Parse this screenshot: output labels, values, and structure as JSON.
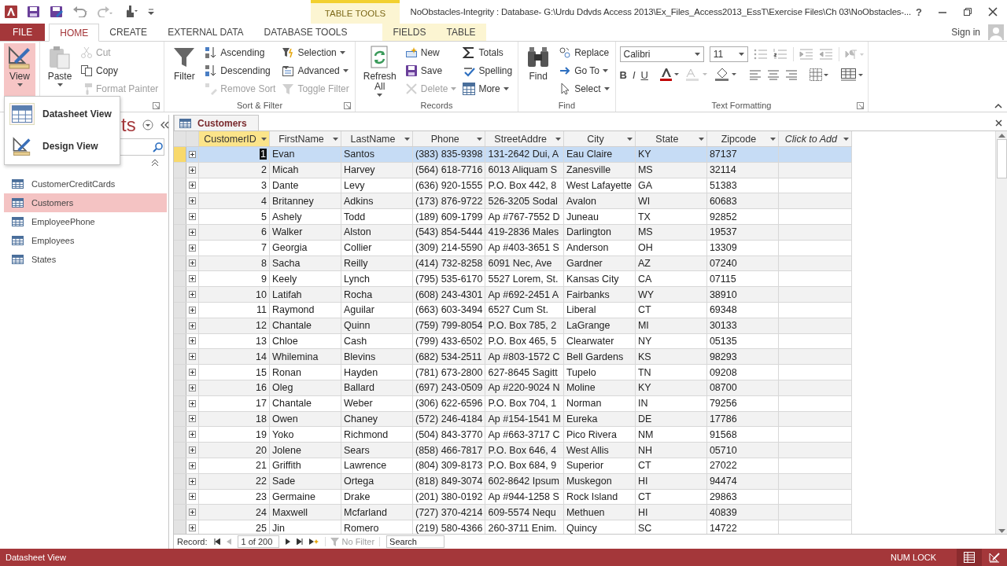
{
  "window": {
    "contextual_header": "TABLE TOOLS",
    "title": "NoObstacles-Integrity : Database- G:\\Urdu Ddvds Access 2013\\Ex_Files_Access2013_EssT\\Exercise Files\\Ch 03\\NoObstacles-...",
    "help": "?"
  },
  "tabs": [
    {
      "label": "FILE",
      "kind": "file",
      "selected": false
    },
    {
      "label": "HOME",
      "kind": "tab",
      "selected": true
    },
    {
      "label": "CREATE",
      "kind": "tab",
      "selected": false
    },
    {
      "label": "EXTERNAL DATA",
      "kind": "tab",
      "selected": false
    },
    {
      "label": "DATABASE TOOLS",
      "kind": "tab",
      "selected": false
    },
    {
      "label": "FIELDS",
      "kind": "contextual",
      "selected": false
    },
    {
      "label": "TABLE",
      "kind": "contextual",
      "selected": false
    }
  ],
  "account": {
    "label": "Sign in"
  },
  "ribbon": {
    "groups": [
      {
        "kind": "buttons",
        "launcher": false,
        "buttons": [
          {
            "kind": "large",
            "label": "View",
            "dropdown": true,
            "disabled": false,
            "open": true
          }
        ]
      },
      {
        "kind": "buttons",
        "launcher": true,
        "buttons": [
          {
            "kind": "large",
            "label": "Paste",
            "dropdown": true,
            "disabled": false,
            "open": false
          },
          {
            "kind": "small",
            "label": "Cut",
            "dropdown": false,
            "disabled": true,
            "open": false
          },
          {
            "kind": "small",
            "label": "Copy",
            "dropdown": false,
            "disabled": false,
            "open": false
          },
          {
            "kind": "small",
            "label": "Format Painter",
            "dropdown": false,
            "disabled": true,
            "open": false
          }
        ]
      },
      {
        "kind": "buttons",
        "label": "Sort & Filter",
        "launcher": true,
        "buttons": [
          {
            "kind": "large",
            "label": "Filter",
            "dropdown": false,
            "disabled": false,
            "open": false
          },
          {
            "kind": "small",
            "label": "Ascending",
            "dropdown": false,
            "disabled": false,
            "open": false
          },
          {
            "kind": "small",
            "label": "Descending",
            "dropdown": false,
            "disabled": false,
            "open": false
          },
          {
            "kind": "small",
            "label": "Remove Sort",
            "dropdown": false,
            "disabled": true,
            "open": false
          },
          {
            "kind": "small",
            "label": "Selection",
            "dropdown": true,
            "disabled": false,
            "open": false
          },
          {
            "kind": "small",
            "label": "Advanced",
            "dropdown": true,
            "disabled": false,
            "open": false
          },
          {
            "kind": "small",
            "label": "Toggle Filter",
            "dropdown": false,
            "disabled": true,
            "open": false
          }
        ]
      },
      {
        "kind": "buttons",
        "label": "Records",
        "launcher": false,
        "buttons": [
          {
            "kind": "large",
            "label": "Refresh All",
            "dropdown": true,
            "disabled": false,
            "open": false
          },
          {
            "kind": "small",
            "label": "New",
            "dropdown": false,
            "disabled": false,
            "open": false
          },
          {
            "kind": "small",
            "label": "Save",
            "dropdown": false,
            "disabled": false,
            "open": false
          },
          {
            "kind": "small",
            "label": "Delete",
            "dropdown": true,
            "disabled": true,
            "open": false
          },
          {
            "kind": "small",
            "label": "Totals",
            "dropdown": false,
            "disabled": false,
            "open": false
          },
          {
            "kind": "small",
            "label": "Spelling",
            "dropdown": false,
            "disabled": false,
            "open": false
          },
          {
            "kind": "small",
            "label": "More",
            "dropdown": true,
            "disabled": false,
            "open": false
          }
        ]
      },
      {
        "kind": "buttons",
        "label": "Find",
        "launcher": false,
        "buttons": [
          {
            "kind": "large",
            "label": "Find",
            "dropdown": false,
            "disabled": false,
            "open": false
          },
          {
            "kind": "small",
            "label": "Replace",
            "dropdown": false,
            "disabled": false,
            "open": false
          },
          {
            "kind": "small",
            "label": "Go To",
            "dropdown": true,
            "disabled": false,
            "open": false
          },
          {
            "kind": "small",
            "label": "Select",
            "dropdown": true,
            "disabled": false,
            "open": false
          }
        ]
      },
      {
        "kind": "format",
        "label": "Text Formatting",
        "launcher": true,
        "font": "Calibri",
        "size": "11",
        "styles": [
          "B",
          "I",
          "U"
        ]
      }
    ]
  },
  "view_menu": {
    "items": [
      {
        "label": "Datasheet View",
        "selected": true
      },
      {
        "label": "Design View",
        "selected": false
      }
    ]
  },
  "navigation_pane": {
    "title": "ts",
    "items": [
      {
        "label": "CustomerCreditCards",
        "selected": false
      },
      {
        "label": "Customers",
        "selected": true
      },
      {
        "label": "EmployeePhone",
        "selected": false
      },
      {
        "label": "Employees",
        "selected": false
      },
      {
        "label": "States",
        "selected": false
      }
    ]
  },
  "document_tabs": [
    {
      "label": "Customers",
      "selected": true
    }
  ],
  "datasheet": {
    "columns": [
      {
        "label": "CustomerID",
        "kind": "field",
        "selected": true
      },
      {
        "label": "FirstName",
        "kind": "field",
        "selected": false
      },
      {
        "label": "LastName",
        "kind": "field",
        "selected": false
      },
      {
        "label": "Phone",
        "kind": "field",
        "selected": false
      },
      {
        "label": "StreetAddre",
        "kind": "field",
        "selected": false
      },
      {
        "label": "City",
        "kind": "field",
        "selected": false
      },
      {
        "label": "State",
        "kind": "field",
        "selected": false
      },
      {
        "label": "Zipcode",
        "kind": "field",
        "selected": false
      },
      {
        "label": "Click to Add",
        "kind": "add",
        "selected": false
      }
    ],
    "rows": [
      {
        "selected": true,
        "cells": [
          "1",
          "Evan",
          "Santos",
          "(383) 835-9398",
          "131-2642 Dui, A",
          "Eau Claire",
          "KY",
          "87137"
        ]
      },
      {
        "selected": false,
        "cells": [
          "2",
          "Micah",
          "Harvey",
          "(564) 618-7716",
          "6013 Aliquam S",
          "Zanesville",
          "MS",
          "32114"
        ]
      },
      {
        "selected": false,
        "cells": [
          "3",
          "Dante",
          "Levy",
          "(636) 920-1555",
          "P.O. Box 442, 8",
          "West Lafayette",
          "GA",
          "51383"
        ]
      },
      {
        "selected": false,
        "cells": [
          "4",
          "Britanney",
          "Adkins",
          "(173) 876-9722",
          "526-3205 Sodal",
          "Avalon",
          "WI",
          "60683"
        ]
      },
      {
        "selected": false,
        "cells": [
          "5",
          "Ashely",
          "Todd",
          "(189) 609-1799",
          "Ap #767-7552 D",
          "Juneau",
          "TX",
          "92852"
        ]
      },
      {
        "selected": false,
        "cells": [
          "6",
          "Walker",
          "Alston",
          "(543) 854-5444",
          "419-2836 Males",
          "Darlington",
          "MS",
          "19537"
        ]
      },
      {
        "selected": false,
        "cells": [
          "7",
          "Georgia",
          "Collier",
          "(309) 214-5590",
          "Ap #403-3651 S",
          "Anderson",
          "OH",
          "13309"
        ]
      },
      {
        "selected": false,
        "cells": [
          "8",
          "Sacha",
          "Reilly",
          "(414) 732-8258",
          "6091 Nec, Ave",
          "Gardner",
          "AZ",
          "07240"
        ]
      },
      {
        "selected": false,
        "cells": [
          "9",
          "Keely",
          "Lynch",
          "(795) 535-6170",
          "5527 Lorem, St.",
          "Kansas City",
          "CA",
          "07115"
        ]
      },
      {
        "selected": false,
        "cells": [
          "10",
          "Latifah",
          "Rocha",
          "(608) 243-4301",
          "Ap #692-2451 A",
          "Fairbanks",
          "WY",
          "38910"
        ]
      },
      {
        "selected": false,
        "cells": [
          "11",
          "Raymond",
          "Aguilar",
          "(663) 603-3494",
          "6527 Cum St.",
          "Liberal",
          "CT",
          "69348"
        ]
      },
      {
        "selected": false,
        "cells": [
          "12",
          "Chantale",
          "Quinn",
          "(759) 799-8054",
          "P.O. Box 785, 2",
          "LaGrange",
          "MI",
          "30133"
        ]
      },
      {
        "selected": false,
        "cells": [
          "13",
          "Chloe",
          "Cash",
          "(799) 433-6502",
          "P.O. Box 465, 5",
          "Clearwater",
          "NY",
          "05135"
        ]
      },
      {
        "selected": false,
        "cells": [
          "14",
          "Whilemina",
          "Blevins",
          "(682) 534-2511",
          "Ap #803-1572 C",
          "Bell Gardens",
          "KS",
          "98293"
        ]
      },
      {
        "selected": false,
        "cells": [
          "15",
          "Ronan",
          "Hayden",
          "(781) 673-2800",
          "627-8645 Sagitt",
          "Tupelo",
          "TN",
          "09208"
        ]
      },
      {
        "selected": false,
        "cells": [
          "16",
          "Oleg",
          "Ballard",
          "(697) 243-0509",
          "Ap #220-9024 N",
          "Moline",
          "KY",
          "08700"
        ]
      },
      {
        "selected": false,
        "cells": [
          "17",
          "Chantale",
          "Weber",
          "(306) 622-6596",
          "P.O. Box 704, 1",
          "Norman",
          "IN",
          "79256"
        ]
      },
      {
        "selected": false,
        "cells": [
          "18",
          "Owen",
          "Chaney",
          "(572) 246-4184",
          "Ap #154-1541 M",
          "Eureka",
          "DE",
          "17786"
        ]
      },
      {
        "selected": false,
        "cells": [
          "19",
          "Yoko",
          "Richmond",
          "(504) 843-3770",
          "Ap #663-3717 C",
          "Pico Rivera",
          "NM",
          "91568"
        ]
      },
      {
        "selected": false,
        "cells": [
          "20",
          "Jolene",
          "Sears",
          "(858) 466-7817",
          "P.O. Box 646, 4",
          "West Allis",
          "NH",
          "05710"
        ]
      },
      {
        "selected": false,
        "cells": [
          "21",
          "Griffith",
          "Lawrence",
          "(804) 309-8173",
          "P.O. Box 684, 9",
          "Superior",
          "CT",
          "27022"
        ]
      },
      {
        "selected": false,
        "cells": [
          "22",
          "Sade",
          "Ortega",
          "(818) 849-3074",
          "602-8642 Ipsum",
          "Muskegon",
          "HI",
          "94474"
        ]
      },
      {
        "selected": false,
        "cells": [
          "23",
          "Germaine",
          "Drake",
          "(201) 380-0192",
          "Ap #944-1258 S",
          "Rock Island",
          "CT",
          "29863"
        ]
      },
      {
        "selected": false,
        "cells": [
          "24",
          "Maxwell",
          "Mcfarland",
          "(727) 370-4214",
          "609-5574 Nequ",
          "Methuen",
          "HI",
          "40839"
        ]
      },
      {
        "selected": false,
        "cells": [
          "25",
          "Jin",
          "Romero",
          "(219) 580-4366",
          "260-3711 Enim.",
          "Quincy",
          "SC",
          "14722"
        ]
      }
    ]
  },
  "record_navigator": {
    "label": "Record:",
    "position": "1 of 200",
    "filter": "No Filter",
    "filter_active": false,
    "search_placeholder": "Search"
  },
  "status_bar": {
    "view": "Datasheet View",
    "indicator": "NUM LOCK",
    "views": [
      {
        "selected": true
      },
      {
        "selected": false
      }
    ]
  }
}
